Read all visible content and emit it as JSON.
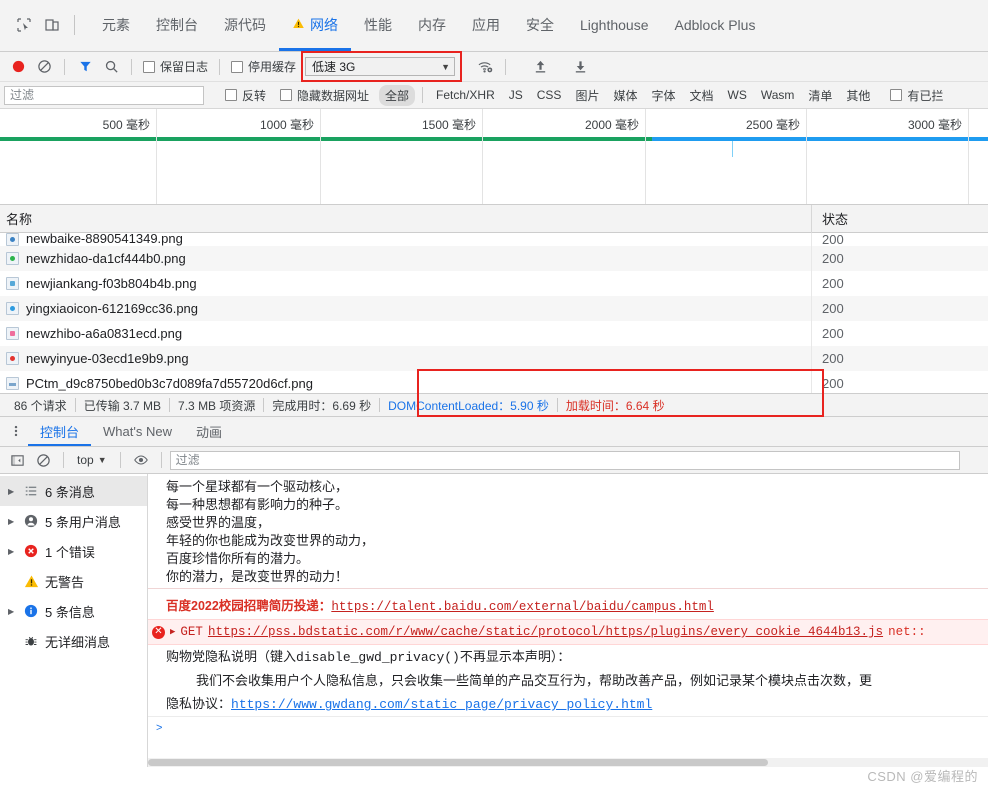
{
  "devtools": {
    "main_tabs": [
      {
        "label": "元素",
        "active": false
      },
      {
        "label": "控制台",
        "active": false
      },
      {
        "label": "源代码",
        "active": false
      },
      {
        "label": "网络",
        "active": true,
        "warning": true
      },
      {
        "label": "性能",
        "active": false
      },
      {
        "label": "内存",
        "active": false
      },
      {
        "label": "应用",
        "active": false
      },
      {
        "label": "安全",
        "active": false
      },
      {
        "label": "Lighthouse",
        "active": false
      },
      {
        "label": "Adblock Plus",
        "active": false
      }
    ],
    "icons": {
      "inspect": "inspect-element-icon",
      "device": "device-toolbar-icon",
      "record": "record-icon",
      "clear": "clear-icon",
      "filter": "filter-funnel-icon",
      "search": "search-icon",
      "network_conditions": "wifi-settings-icon",
      "import": "import-har-icon",
      "export": "export-har-icon",
      "warning": "warning-triangle-icon"
    }
  },
  "network_toolbar": {
    "preserve_log_label": "保留日志",
    "disable_cache_label": "停用缓存",
    "throttle_value": "低速 3G",
    "throttle_highlight_color": "#e8231f"
  },
  "filter_bar": {
    "filter_placeholder": "过滤",
    "filter_value": "",
    "invert_label": "反转",
    "hide_data_urls_label": "隐藏数据网址",
    "types": [
      "全部",
      "Fetch/XHR",
      "JS",
      "CSS",
      "图片",
      "媒体",
      "字体",
      "文档",
      "WS",
      "Wasm",
      "清单",
      "其他"
    ],
    "selected_type": "全部",
    "blocked_label": "有已拦"
  },
  "timeline": {
    "ticks": [
      "500 毫秒",
      "1000 毫秒",
      "1500 毫秒",
      "2000 毫秒",
      "2500 毫秒",
      "3000 毫秒"
    ],
    "green_end_ms": 2100,
    "total_ms": 3400,
    "colors": {
      "green": "#1aa260",
      "blue": "#1f9cf0"
    }
  },
  "request_table": {
    "columns": [
      "名称",
      "状态"
    ],
    "rows": [
      {
        "name": "newbaike-8890541349.png",
        "status": "200",
        "icon_class": "c1"
      },
      {
        "name": "newzhidao-da1cf444b0.png",
        "status": "200",
        "icon_class": "c2"
      },
      {
        "name": "newjiankang-f03b804b4b.png",
        "status": "200",
        "icon_class": "c3"
      },
      {
        "name": "yingxiaoicon-612169cc36.png",
        "status": "200",
        "icon_class": "c4"
      },
      {
        "name": "newzhibo-a6a0831ecd.png",
        "status": "200",
        "icon_class": "c5"
      },
      {
        "name": "newyinyue-03ecd1e9b9.png",
        "status": "200",
        "icon_class": "c6"
      },
      {
        "name": "PCtm_d9c8750bed0b3c7d089fa7d55720d6cf.png",
        "status": "200",
        "icon_class": "c7"
      }
    ]
  },
  "summary": {
    "requests": "86 个请求",
    "transferred": "已传输 3.7 MB",
    "resources": "7.3 MB 项资源",
    "finish": "完成用时：6.69 秒",
    "dom_content_loaded": "DOMContentLoaded：5.90 秒",
    "load": "加载时间：6.64 秒",
    "dcl_color": "#1a73e8",
    "load_color": "#d93025"
  },
  "drawer": {
    "tabs": [
      {
        "label": "控制台",
        "active": true
      },
      {
        "label": "What's New",
        "active": false
      },
      {
        "label": "动画",
        "active": false
      }
    ],
    "toolbar": {
      "sidebar_toggle": "show-console-sidebar-icon",
      "clear": "clear-console-icon",
      "context": "top",
      "eye": "live-expression-icon",
      "filter_placeholder": "过滤",
      "filter_value": ""
    },
    "sidebar": [
      {
        "label": "6 条消息",
        "icon": "messages-list-icon",
        "expandable": true,
        "selected": true
      },
      {
        "label": "5 条用户消息",
        "icon": "user-message-icon",
        "expandable": true,
        "selected": false
      },
      {
        "label": "1 个错误",
        "icon": "error-icon",
        "expandable": true,
        "selected": false
      },
      {
        "label": "无警告",
        "icon": "warning-icon",
        "expandable": false,
        "selected": false
      },
      {
        "label": "5 条信息",
        "icon": "info-icon",
        "expandable": false,
        "selected": false,
        "expandable_info": true
      },
      {
        "label": "无详细消息",
        "icon": "verbose-bug-icon",
        "expandable": false,
        "selected": false
      }
    ]
  },
  "console": {
    "poem": [
      "每一个星球都有一个驱动核心，",
      "每一种思想都有影响力的种子。",
      "感受世界的温度，",
      "年轻的你也能成为改变世界的动力，",
      "百度珍惜你所有的潜力。",
      "你的潜力，是改变世界的动力！"
    ],
    "recruit": {
      "label": "百度2022校园招聘简历投递：",
      "url": "https://talent.baidu.com/external/baidu/campus.html"
    },
    "error": {
      "method": "GET",
      "url": "https://pss.bdstatic.com/r/www/cache/static/protocol/https/plugins/every_cookie_4644b13.js",
      "suffix": "net::"
    },
    "privacy": {
      "heading_pre": "购物党隐私说明（键入",
      "heading_code": "disable_gwd_privacy()",
      "heading_post": "不再显示本声明）：",
      "body": "我们不会收集用户个人隐私信息，只会收集一些简单的产品交互行为，帮助改善产品，例如记录某个模块点击次数，更",
      "agreement_label": "隐私协议：",
      "agreement_url": "https://www.gwdang.com/static_page/privacy_policy.html"
    }
  },
  "watermark": "CSDN @爱编程的"
}
